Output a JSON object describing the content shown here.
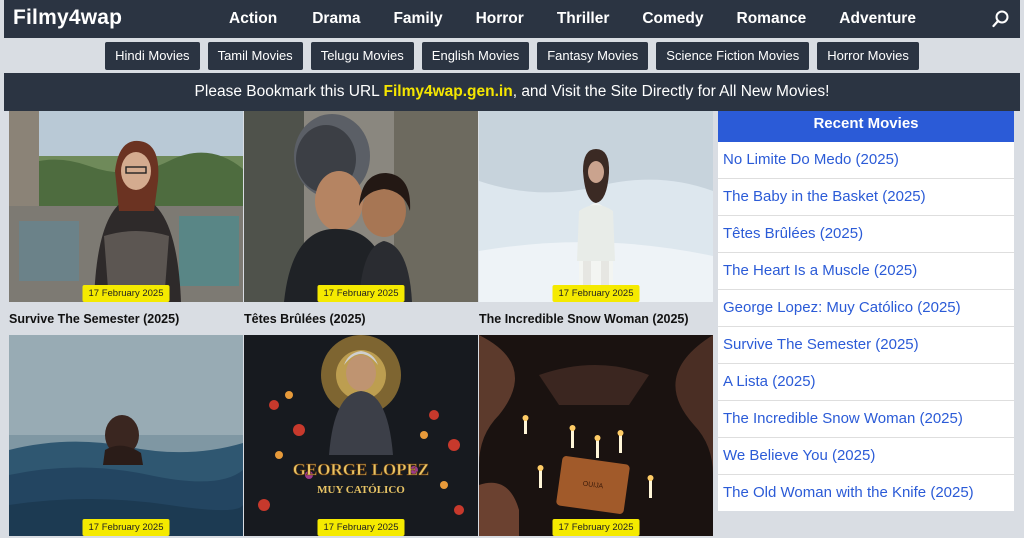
{
  "site": {
    "logo": "Filmy4wap"
  },
  "nav": {
    "links": [
      "Action",
      "Drama",
      "Family",
      "Horror",
      "Thriller",
      "Comedy",
      "Romance",
      "Adventure"
    ],
    "search_icon": "search-icon"
  },
  "categories": [
    "Hindi Movies",
    "Tamil Movies",
    "Telugu Movies",
    "English Movies",
    "Fantasy Movies",
    "Science Fiction Movies",
    "Horror Movies"
  ],
  "notice": {
    "before": "Please Bookmark this URL ",
    "url": "Filmy4wap.gen.in",
    "after": ", and Visit the Site Directly for All New Movies!"
  },
  "colors": {
    "nav_bg": "#2b3442",
    "accent_blue": "#2b5bd7",
    "badge_yellow": "#f5ea00",
    "notice_highlight": "#f5e600"
  },
  "movies": [
    {
      "title": "Survive The Semester (2025)",
      "date": "17 February 2025"
    },
    {
      "title": "Têtes Brûlées (2025)",
      "date": "17 February 2025"
    },
    {
      "title": "The Incredible Snow Woman (2025)",
      "date": "17 February 2025"
    },
    {
      "title": "",
      "date": "17 February 2025"
    },
    {
      "title": "",
      "date": "17 February 2025"
    },
    {
      "title": "",
      "date": "17 February 2025"
    }
  ],
  "sidebar": {
    "heading": "Recent Movies",
    "items": [
      "No Limite Do Medo (2025)",
      "The Baby in the Basket (2025)",
      "Têtes Brûlées (2025)",
      "The Heart Is a Muscle (2025)",
      "George Lopez: Muy Católico (2025)",
      "Survive The Semester (2025)",
      "A Lista (2025)",
      "The Incredible Snow Woman (2025)",
      "We Believe You (2025)",
      "The Old Woman with the Knife (2025)"
    ]
  }
}
